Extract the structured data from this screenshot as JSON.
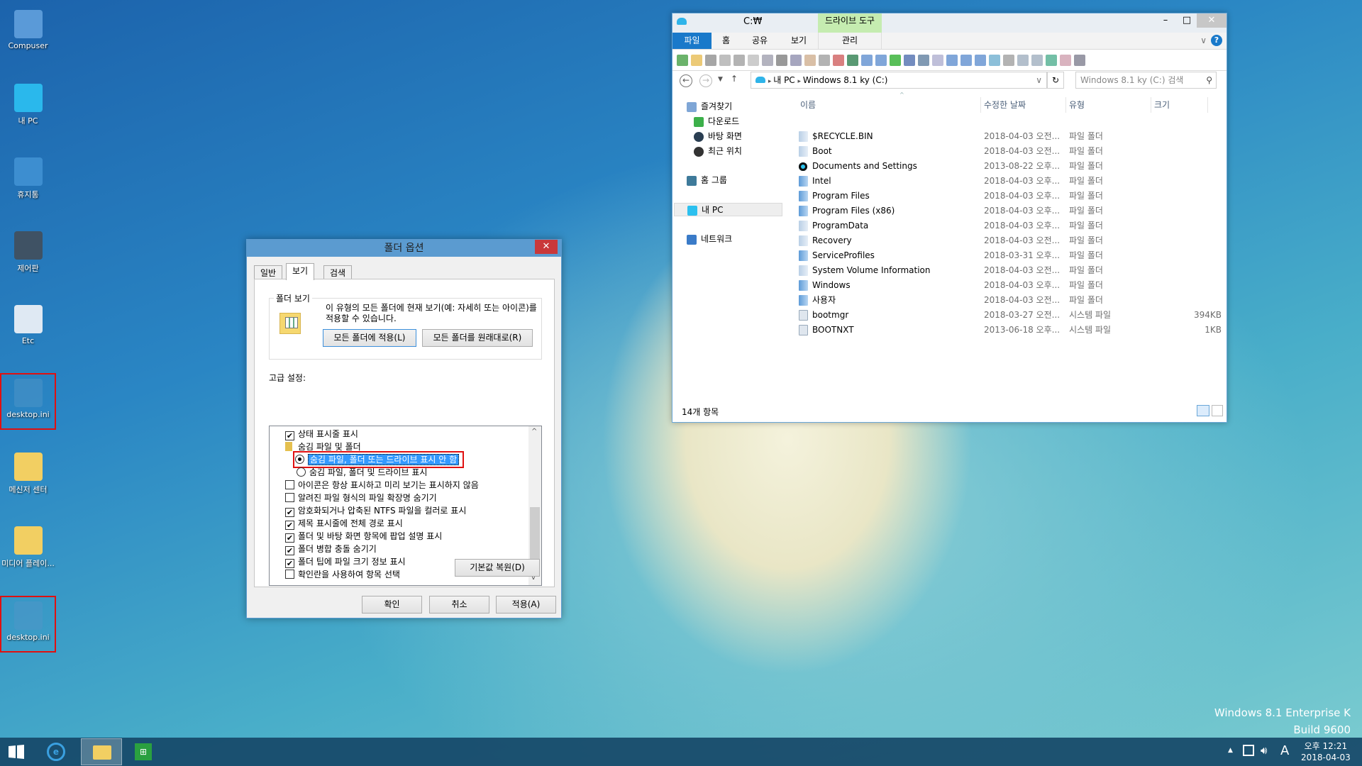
{
  "desktop": {
    "icons": [
      {
        "label": "Compuser",
        "icon": "user-folder-icon"
      },
      {
        "label": "내 PC",
        "icon": "computer-icon"
      },
      {
        "label": "휴지통",
        "icon": "recycle-bin-icon"
      },
      {
        "label": "제어판",
        "icon": "control-panel-icon"
      },
      {
        "label": "Etc",
        "icon": "folder-icon"
      },
      {
        "label": "desktop.ini",
        "icon": "settings-file-icon",
        "highlighted": true
      },
      {
        "label": "메신저 센터",
        "icon": "folder-shortcut-icon"
      },
      {
        "label": "미디어 플레이...",
        "icon": "media-folder-icon"
      },
      {
        "label": "desktop.ini",
        "icon": "settings-file-icon",
        "highlighted": true
      }
    ],
    "watermark": {
      "line1": "Windows 8.1 Enterprise K",
      "line2": "Build 9600"
    }
  },
  "explorer": {
    "title": "C:₩",
    "context_tab": "드라이브 도구",
    "ribbon_tabs": [
      "파일",
      "홈",
      "공유",
      "보기",
      "관리"
    ],
    "address": {
      "segments": [
        "내 PC",
        "Windows 8.1 ky (C:)"
      ]
    },
    "search_placeholder": "Windows 8.1 ky (C:) 검색",
    "nav": {
      "favorites": "즐겨찾기",
      "favorites_items": [
        "다운로드",
        "바탕 화면",
        "최근 위치"
      ],
      "homegroup": "홈 그룹",
      "this_pc": "내 PC",
      "network": "네트워크"
    },
    "columns": [
      "이름",
      "수정한 날짜",
      "유형",
      "크기"
    ],
    "files": [
      {
        "name": "$RECYCLE.BIN",
        "date": "2018-04-03 오전...",
        "type": "파일 폴더",
        "size": "",
        "icon": "hidden-folder-icon"
      },
      {
        "name": "Boot",
        "date": "2018-04-03 오전...",
        "type": "파일 폴더",
        "size": "",
        "icon": "hidden-folder-icon"
      },
      {
        "name": "Documents and Settings",
        "date": "2013-08-22 오후...",
        "type": "파일 폴더",
        "size": "",
        "icon": "junction-icon"
      },
      {
        "name": "Intel",
        "date": "2018-04-03 오후...",
        "type": "파일 폴더",
        "size": "",
        "icon": "folder-icon"
      },
      {
        "name": "Program Files",
        "date": "2018-04-03 오후...",
        "type": "파일 폴더",
        "size": "",
        "icon": "folder-icon"
      },
      {
        "name": "Program Files (x86)",
        "date": "2018-04-03 오후...",
        "type": "파일 폴더",
        "size": "",
        "icon": "folder-icon"
      },
      {
        "name": "ProgramData",
        "date": "2018-04-03 오후...",
        "type": "파일 폴더",
        "size": "",
        "icon": "hidden-folder-icon"
      },
      {
        "name": "Recovery",
        "date": "2018-04-03 오전...",
        "type": "파일 폴더",
        "size": "",
        "icon": "hidden-folder-icon"
      },
      {
        "name": "ServiceProfiles",
        "date": "2018-03-31 오후...",
        "type": "파일 폴더",
        "size": "",
        "icon": "folder-icon"
      },
      {
        "name": "System Volume Information",
        "date": "2018-04-03 오전...",
        "type": "파일 폴더",
        "size": "",
        "icon": "hidden-folder-icon"
      },
      {
        "name": "Windows",
        "date": "2018-04-03 오후...",
        "type": "파일 폴더",
        "size": "",
        "icon": "folder-icon"
      },
      {
        "name": "사용자",
        "date": "2018-04-03 오전...",
        "type": "파일 폴더",
        "size": "",
        "icon": "folder-icon"
      },
      {
        "name": "bootmgr",
        "date": "2018-03-27 오전...",
        "type": "시스템 파일",
        "size": "394KB",
        "icon": "system-file-icon"
      },
      {
        "name": "BOOTNXT",
        "date": "2013-06-18 오후...",
        "type": "시스템 파일",
        "size": "1KB",
        "icon": "system-file-icon"
      }
    ],
    "status": "14개 항목"
  },
  "dialog": {
    "title": "폴더 옵션",
    "tabs": [
      "일반",
      "보기",
      "검색"
    ],
    "active_tab": "보기",
    "folder_views": {
      "legend": "폴더 보기",
      "description": "이 유형의 모든 폴더에 현재 보기(예: 자세히 또는 아이콘)를 적용할 수 있습니다.",
      "apply_button": "모든 폴더에 적용(L)",
      "reset_button": "모든 폴더를 원래대로(R)"
    },
    "advanced_label": "고급 설정:",
    "settings": [
      {
        "kind": "checkbox",
        "label": "상태 표시줄 표시",
        "checked": true
      },
      {
        "kind": "folder",
        "label": "숨김 파일 및 폴더"
      },
      {
        "kind": "radio",
        "label": "숨김 파일, 폴더 또는 드라이브 표시 안 함",
        "checked": true,
        "selected": true
      },
      {
        "kind": "radio",
        "label": "숨김 파일, 폴더 및 드라이브 표시",
        "checked": false
      },
      {
        "kind": "checkbox",
        "label": "아이콘은 항상 표시하고 미리 보기는 표시하지 않음",
        "checked": false
      },
      {
        "kind": "checkbox",
        "label": "알려진 파일 형식의 파일 확장명 숨기기",
        "checked": false
      },
      {
        "kind": "checkbox",
        "label": "암호화되거나 압축된 NTFS 파일을 컬러로 표시",
        "checked": true
      },
      {
        "kind": "checkbox",
        "label": "제목 표시줄에 전체 경로 표시",
        "checked": true
      },
      {
        "kind": "checkbox",
        "label": "폴더 및 바탕 화면 항목에 팝업 설명 표시",
        "checked": true
      },
      {
        "kind": "checkbox",
        "label": "폴더 병합 충돌 숨기기",
        "checked": true
      },
      {
        "kind": "checkbox",
        "label": "폴더 팁에 파일 크기 정보 표시",
        "checked": true
      },
      {
        "kind": "checkbox",
        "label": "확인란을 사용하여 항목 선택",
        "checked": false
      }
    ],
    "restore_button": "기본값 복원(D)",
    "ok": "확인",
    "cancel": "취소",
    "apply": "적용(A)"
  },
  "taskbar": {
    "time": "오후 12:21",
    "date": "2018-04-03",
    "ime": "A"
  },
  "colors": {
    "accent": "#1979ca",
    "dialog_title": "#5b9bd0",
    "close": "#c9383a",
    "highlight_box": "#e01010",
    "selection": "#3399ff"
  }
}
